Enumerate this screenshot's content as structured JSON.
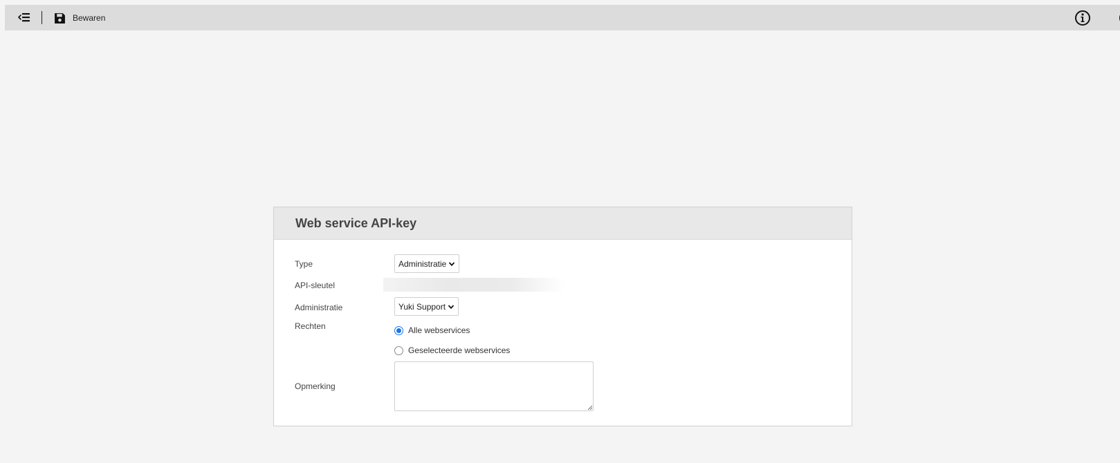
{
  "toolbar": {
    "menu_icon": "collapse-menu-icon",
    "save_icon": "floppy-disk-icon",
    "save_label": "Bewaren",
    "info_icon": "info-circle-icon",
    "close_icon": "close-circle-icon"
  },
  "panel": {
    "title": "Web service API-key",
    "fields": {
      "type": {
        "label": "Type",
        "value": "Administratie"
      },
      "api_key": {
        "label": "API-sleutel"
      },
      "administration": {
        "label": "Administratie",
        "value": "Yuki Support"
      },
      "rights": {
        "label": "Rechten",
        "options": [
          {
            "label": "Alle webservices",
            "checked": true
          },
          {
            "label": "Geselecteerde webservices",
            "checked": false
          }
        ]
      },
      "remark": {
        "label": "Opmerking",
        "value": ""
      }
    }
  },
  "colors": {
    "toolbar_bg": "#dcdcdc",
    "page_bg": "#f4f4f4",
    "panel_header_bg": "#e8e8e8",
    "radio_accent": "#1a73e8"
  }
}
